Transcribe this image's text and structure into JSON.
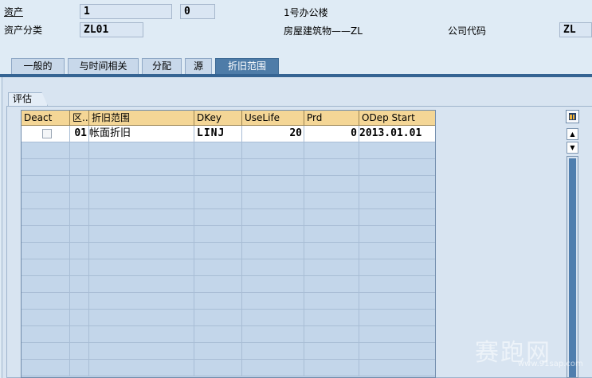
{
  "header": {
    "asset_label": "资产",
    "asset_number": "1",
    "asset_subnumber": "0",
    "asset_description": "1号办公楼",
    "asset_class_label": "资产分类",
    "asset_class_value": "ZL01",
    "asset_class_description": "房屋建筑物——ZL",
    "company_code_label": "公司代码",
    "company_code_value": "ZL"
  },
  "tabs": [
    {
      "label": "一般的",
      "active": false
    },
    {
      "label": "与时间相关",
      "active": false
    },
    {
      "label": "分配",
      "active": false
    },
    {
      "label": "源",
      "active": false
    },
    {
      "label": "折旧范围",
      "active": true
    }
  ],
  "group_title": "评估",
  "table": {
    "columns": [
      "Deact",
      "区...",
      "折旧范围",
      "DKey",
      "UseLife",
      "Prd",
      "ODep Start"
    ],
    "rows": [
      {
        "deact": "",
        "area": "01",
        "area_name": "帐面折旧",
        "dkey": "LINJ",
        "uselife": "20",
        "prd": "0",
        "odep_start": "2013.01.01"
      }
    ],
    "empty_rows": 14
  },
  "scroll": {
    "up_glyph": "▲",
    "down_glyph": "▼"
  },
  "watermark": {
    "text": "赛跑网",
    "url": "www.91sap.com"
  }
}
